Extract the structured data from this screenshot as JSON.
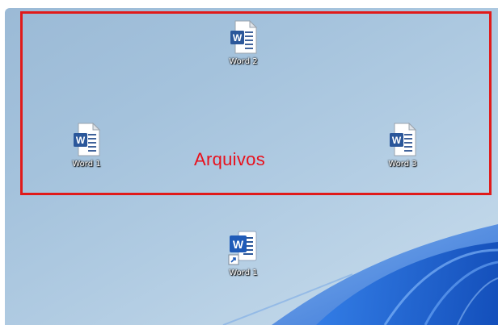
{
  "selection": {
    "label": "Arquivos",
    "border_color": "#e01a1a",
    "label_color": "#e8101c"
  },
  "icons": [
    {
      "label": "Word 2",
      "icon": "word-document-icon",
      "shortcut": false
    },
    {
      "label": "Word 1",
      "icon": "word-document-icon",
      "shortcut": false
    },
    {
      "label": "Word 3",
      "icon": "word-document-icon",
      "shortcut": false
    },
    {
      "label": "Word 1",
      "icon": "word-shortcut-icon",
      "shortcut": true
    }
  ],
  "colors": {
    "word_blue": "#2b579a",
    "wallpaper_bloom": "#1e6ad6"
  }
}
